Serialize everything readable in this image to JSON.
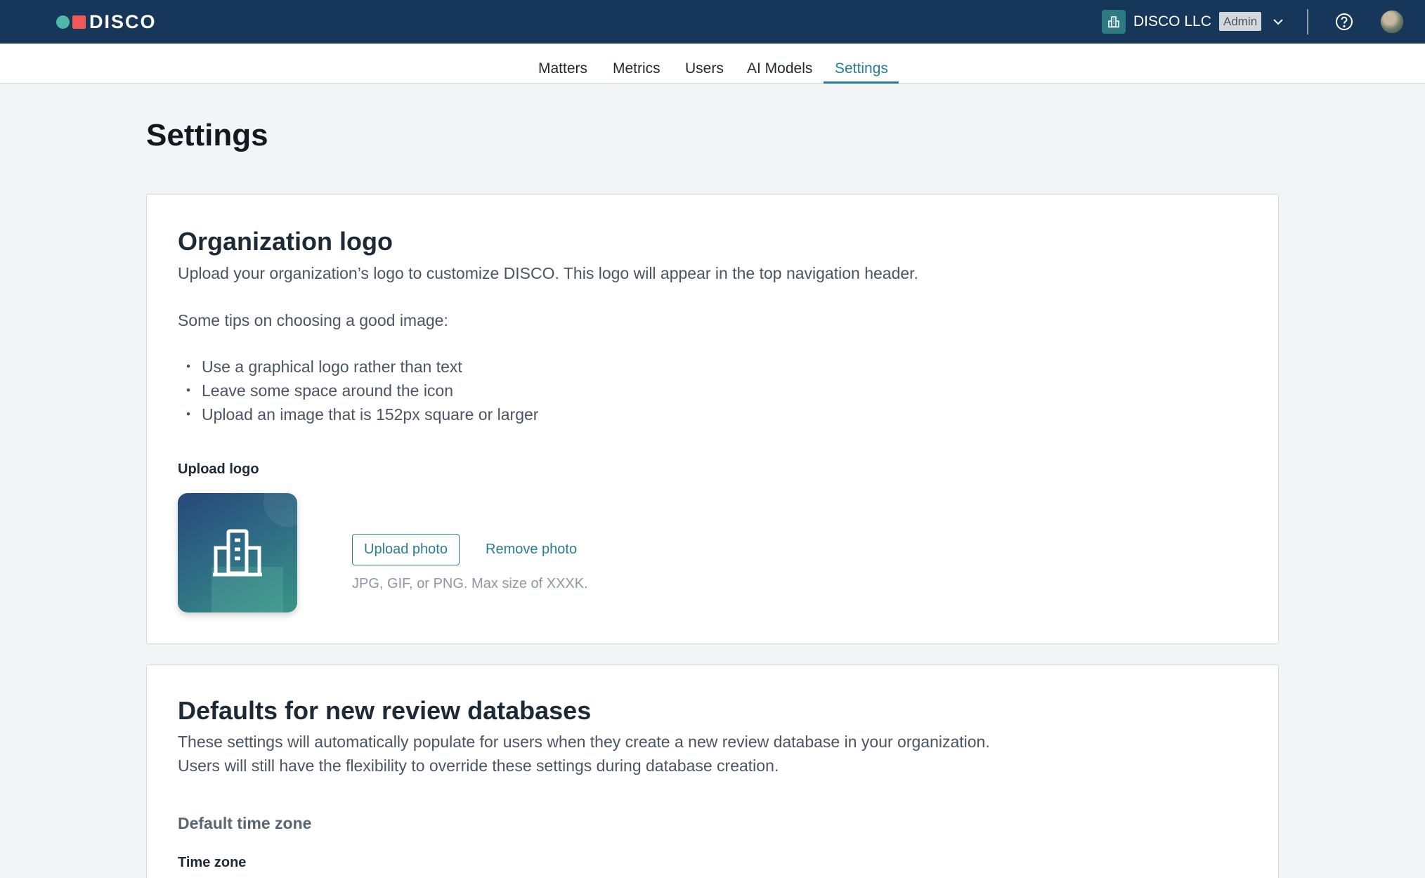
{
  "header": {
    "brand": "DISCO",
    "org_name": "DISCO LLC",
    "role_badge": "Admin"
  },
  "tabs": [
    {
      "label": "Matters"
    },
    {
      "label": "Metrics"
    },
    {
      "label": "Users"
    },
    {
      "label": "AI Models"
    },
    {
      "label": "Settings",
      "active": true
    }
  ],
  "page": {
    "title": "Settings"
  },
  "org_logo": {
    "title": "Organization logo",
    "description": "Upload your organization’s logo to customize DISCO. This logo will appear in the top navigation header.",
    "tips_intro": "Some tips on choosing a good image:",
    "tips": [
      "Use a graphical logo rather than text",
      "Leave some space around the icon",
      "Upload an image that is 152px square or larger"
    ],
    "upload_label": "Upload logo",
    "upload_button": "Upload photo",
    "remove_button": "Remove photo",
    "hint": "JPG, GIF, or PNG. Max size of XXXK."
  },
  "defaults": {
    "title": "Defaults for new review databases",
    "description_line1": "These settings will automatically populate for users when they create a new review database in your organization.",
    "description_line2": "Users will still have the flexibility to override these settings during database creation.",
    "timezone_heading": "Default time zone",
    "timezone_label": "Time zone"
  },
  "colors": {
    "header_bg": "#16365a",
    "accent": "#2a7c96",
    "brand_teal": "#4fb7a6",
    "brand_red": "#ef5a58"
  }
}
